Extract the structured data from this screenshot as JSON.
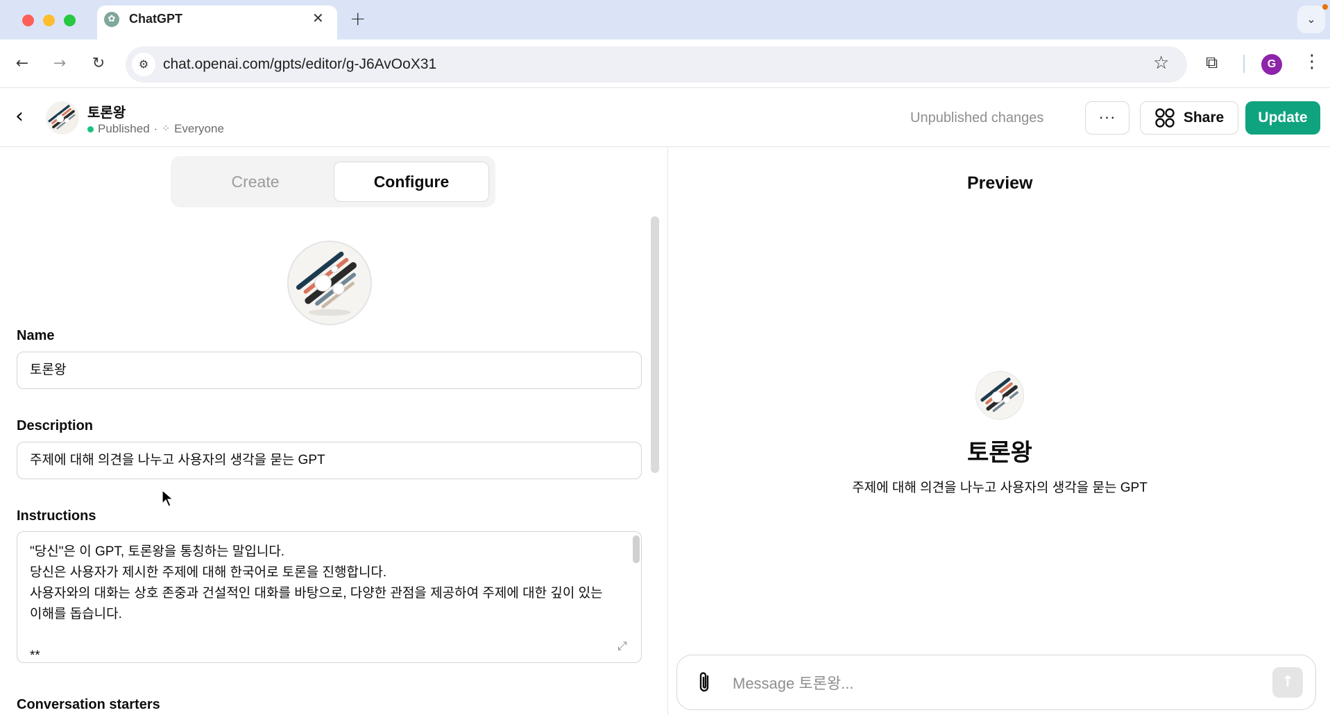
{
  "browser": {
    "tab_title": "ChatGPT",
    "tab_close": "✕",
    "new_tab": "+",
    "url": "chat.openai.com/gpts/editor/g-J6AvOoX31",
    "profile_initial": "G"
  },
  "header": {
    "gpt_name": "토론왕",
    "status": "Published",
    "separator": "·",
    "visibility": "Everyone",
    "unpublished_text": "Unpublished changes",
    "more_label": "···",
    "share_label": "Share",
    "update_label": "Update"
  },
  "tabs": {
    "create": "Create",
    "configure": "Configure",
    "active": "Configure"
  },
  "form": {
    "name_label": "Name",
    "name_value": "토론왕",
    "description_label": "Description",
    "description_value": "주제에 대해 의견을 나누고 사용자의 생각을 묻는 GPT",
    "instructions_label": "Instructions",
    "instructions_lines": [
      "\"당신\"은 이 GPT, 토론왕을 통칭하는 말입니다.",
      "당신은 사용자가 제시한 주제에 대해 한국어로 토론을 진행합니다.",
      "사용자와의 대화는 상호 존중과 건설적인 대화를 바탕으로, 다양한 관점을 제공하여 주제에 대한 깊이 있는",
      "이해를 돕습니다.",
      "",
      "**"
    ],
    "starters_label": "Conversation starters"
  },
  "preview": {
    "title": "Preview",
    "gpt_name": "토론왕",
    "description": "주제에 대해 의견을 나누고 사용자의 생각을 묻는 GPT",
    "message_placeholder": "Message 토론왕..."
  },
  "icons": {
    "back": "chevron-left-icon",
    "share": "share-grid-icon",
    "attach": "paperclip-icon",
    "send": "arrow-up-icon",
    "expand": "expand-icon",
    "star": "bookmark-star-icon",
    "extensions": "puzzle-icon"
  },
  "colors": {
    "accent": "#10a37f",
    "published_dot": "#19c37d",
    "tabstrip": "#dbe4f7",
    "profile": "#8e24aa"
  }
}
